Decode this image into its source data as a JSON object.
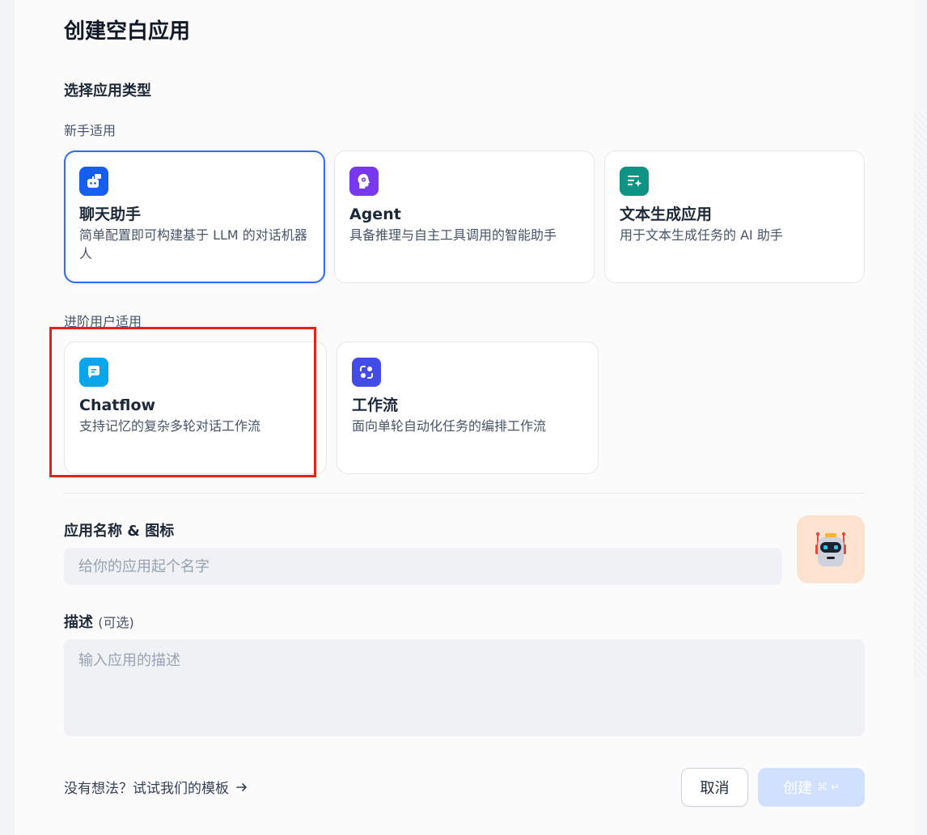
{
  "dialog": {
    "title": "创建空白应用"
  },
  "app_type": {
    "section_title": "选择应用类型",
    "beginner_label": "新手适用",
    "advanced_label": "进阶用户适用",
    "beginner": [
      {
        "title": "聊天助手",
        "desc": "简单配置即可构建基于 LLM 的对话机器人",
        "icon": "chat-bot-icon",
        "color": "#155eef",
        "selected": true
      },
      {
        "title": "Agent",
        "desc": "具备推理与自主工具调用的智能助手",
        "icon": "agent-brain-icon",
        "color": "#7839ee",
        "selected": false
      },
      {
        "title": "文本生成应用",
        "desc": "用于文本生成任务的 AI 助手",
        "icon": "text-generate-icon",
        "color": "#0e9384",
        "selected": false
      }
    ],
    "advanced": [
      {
        "title": "Chatflow",
        "desc": "支持记忆的复杂多轮对话工作流",
        "icon": "chatflow-icon",
        "color": "#0ba5ec"
      },
      {
        "title": "工作流",
        "desc": "面向单轮自动化任务的编排工作流",
        "icon": "workflow-icon",
        "color": "#444ce7"
      }
    ]
  },
  "name_field": {
    "label": "应用名称 & 图标",
    "placeholder": "给你的应用起个名字",
    "value": ""
  },
  "desc_field": {
    "label": "描述",
    "optional": "(可选)",
    "placeholder": "输入应用的描述",
    "value": ""
  },
  "avatar": {
    "icon": "robot-icon",
    "bg": "#fde3cf"
  },
  "footer": {
    "template_link": "没有想法？试试我们的模板",
    "cancel_label": "取消",
    "create_label": "创建",
    "create_shortcut": "⌘ ↵"
  },
  "colors": {
    "primary": "#2d6ef0",
    "highlight": "#e8201a"
  }
}
